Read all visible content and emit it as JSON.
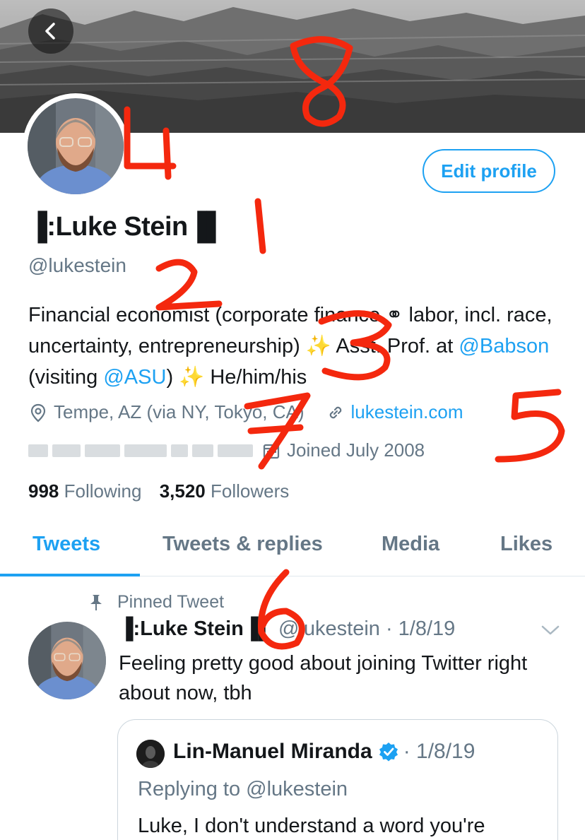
{
  "header": {
    "back_icon": "chevron-left-icon"
  },
  "profile": {
    "edit_button": "Edit profile",
    "name": "▐:Luke Stein▐▌",
    "handle": "@lukestein",
    "bio": {
      "part1": "Financial economist (corporate finance ⚭ labor, incl. race, uncertainty, entrepreneurship) ✨  Asst. Prof. at ",
      "mention1": "@Babson",
      "part2": " (visiting ",
      "mention2": "@ASU",
      "part3": ") ✨  He/him/his"
    },
    "location": "Tempe, AZ (via NY, Tokyo, CA)",
    "website": "lukestein.com",
    "joined": "Joined July 2008",
    "following_count": "998",
    "following_label": "Following",
    "followers_count": "3,520",
    "followers_label": "Followers"
  },
  "tabs": [
    {
      "label": "Tweets",
      "active": true
    },
    {
      "label": "Tweets & replies",
      "active": false
    },
    {
      "label": "Media",
      "active": false
    },
    {
      "label": "Likes",
      "active": false
    }
  ],
  "pinned_tweet": {
    "pinned_label": "Pinned Tweet",
    "author_name": "▐:Luke Stein▐▌",
    "meta": "@lukestein · 1/8/19",
    "text": "Feeling pretty good about joining Twitter right about now, tbh",
    "quote": {
      "author_name": "Lin-Manuel Miranda",
      "meta": "· 1/8/19",
      "replying_to": "Replying to @lukestein",
      "text": "Luke, I don't understand a word you're"
    }
  },
  "annotations": [
    "8",
    "4",
    "1",
    "2",
    "3",
    "7",
    "5",
    "6"
  ],
  "colors": {
    "accent": "#1da1f2",
    "secondary_text": "#657786",
    "primary_text": "#14171a",
    "annotation_red": "#f4280e",
    "border": "#e1e8ed"
  }
}
